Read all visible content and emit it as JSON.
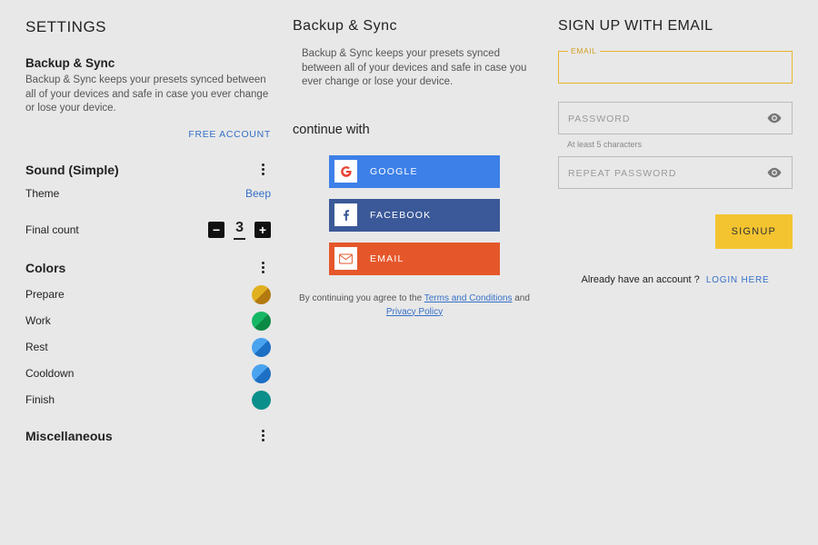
{
  "settings": {
    "title": "SETTINGS",
    "backup": {
      "heading": "Backup & Sync",
      "desc": "Backup & Sync keeps your presets synced between all of your devices and safe in case you ever change or lose your device.",
      "free_account": "FREE ACCOUNT"
    },
    "sound": {
      "heading": "Sound (Simple)",
      "theme_label": "Theme",
      "theme_value": "Beep",
      "final_count_label": "Final count",
      "final_count_value": "3"
    },
    "colors": {
      "heading": "Colors",
      "items": [
        {
          "label": "Prepare",
          "color1": "#c19a1a",
          "color2": "#9c6a0e"
        },
        {
          "label": "Work",
          "color1": "#1aa55a",
          "color2": "#0b7a3f"
        },
        {
          "label": "Rest",
          "color1": "#3a8be0",
          "color2": "#1e63b8"
        },
        {
          "label": "Cooldown",
          "color1": "#3a8be0",
          "color2": "#1e63b8"
        },
        {
          "label": "Finish",
          "color1": "#0b8f8a",
          "color2": "#0b8f8a"
        }
      ]
    },
    "misc": {
      "heading": "Miscellaneous"
    }
  },
  "backup_panel": {
    "title": "Backup & Sync",
    "desc": "Backup & Sync keeps your presets synced between all of your devices and safe in case you ever change or lose your device.",
    "continue_with": "continue with",
    "buttons": {
      "google": "GOOGLE",
      "facebook": "FACEBOOK",
      "email": "EMAIL"
    },
    "agree_prefix": "By continuing you agree to the ",
    "terms": "Terms and Conditions",
    "and": " and ",
    "privacy": "Privacy Policy"
  },
  "signup": {
    "title": "SIGN UP WITH EMAIL",
    "email_label": "EMAIL",
    "password_placeholder": "PASSWORD",
    "password_helper": "At least 5 characters",
    "repeat_placeholder": "REPEAT PASSWORD",
    "signup_button": "SIGNUP",
    "already_text": "Already have an account ?",
    "login_here": "LOGIN HERE"
  }
}
